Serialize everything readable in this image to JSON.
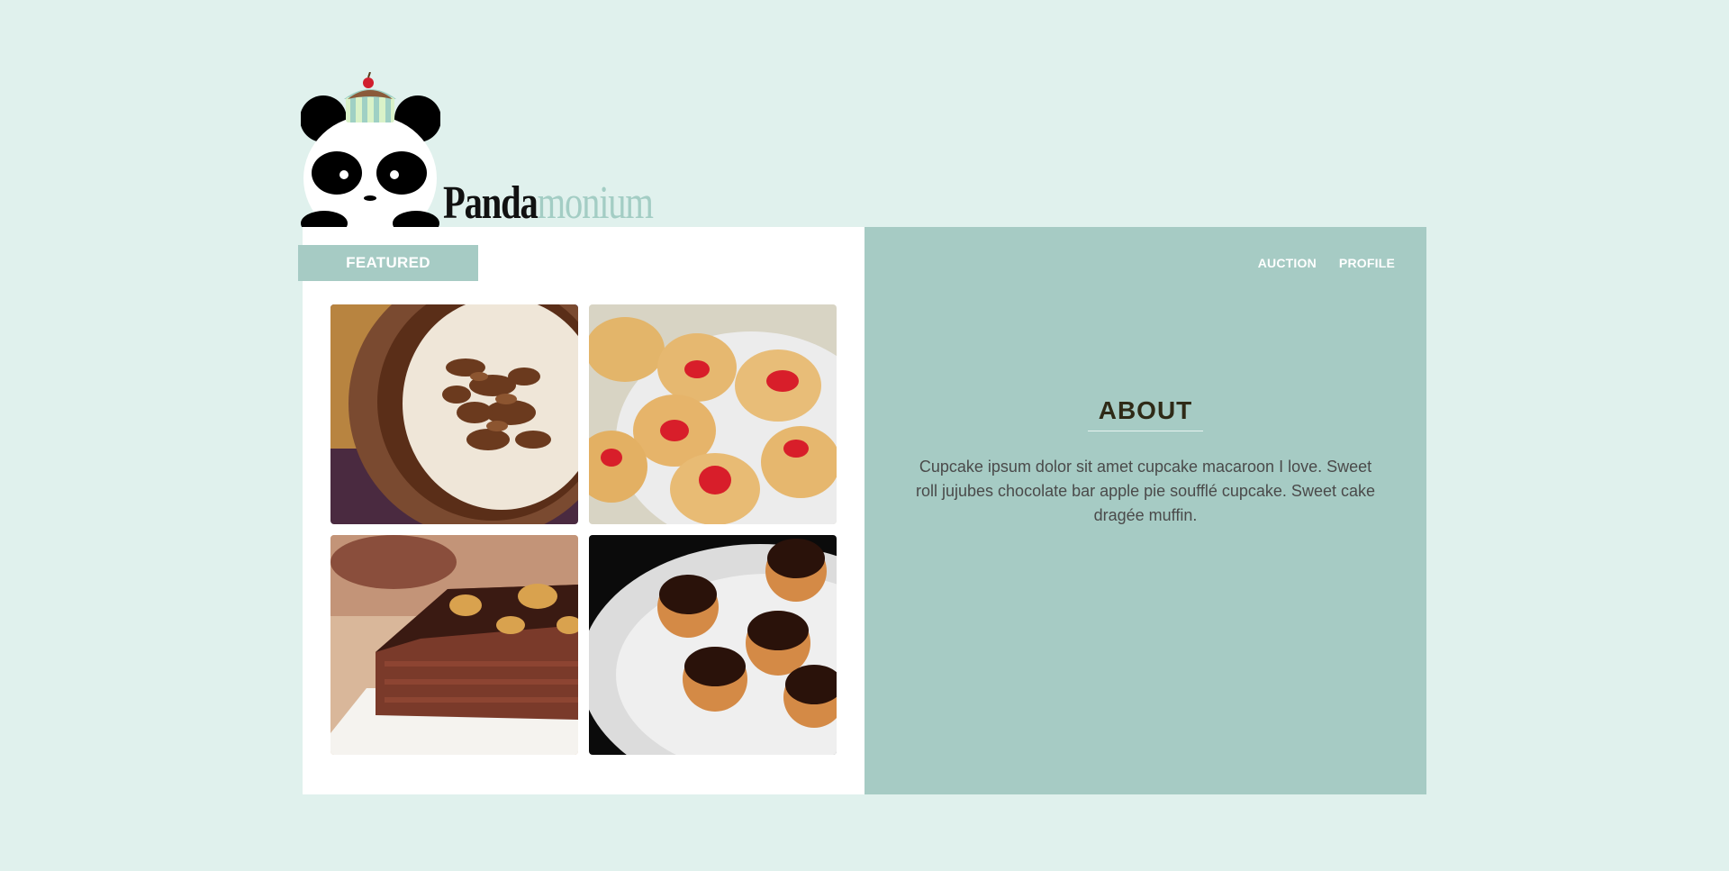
{
  "brand": {
    "name_part1": "Panda",
    "name_part2": "monium"
  },
  "featured": {
    "tab_label": "FEATURED",
    "items": [
      {
        "name": "chocolate-curl-pie"
      },
      {
        "name": "jam-pastries"
      },
      {
        "name": "walnut-brownie"
      },
      {
        "name": "chocolate-profiteroles"
      }
    ]
  },
  "nav": {
    "items": [
      "AUCTION",
      "PROFILE"
    ]
  },
  "about": {
    "title": "ABOUT",
    "text": "Cupcake ipsum dolor sit amet cupcake macaroon I love. Sweet roll jujubes chocolate bar apple pie soufflé cupcake. Sweet cake dragée muffin."
  },
  "colors": {
    "background": "#e0f1ed",
    "accent": "#a6cbc4",
    "panel": "#ffffff",
    "heading": "#2f2a17"
  }
}
